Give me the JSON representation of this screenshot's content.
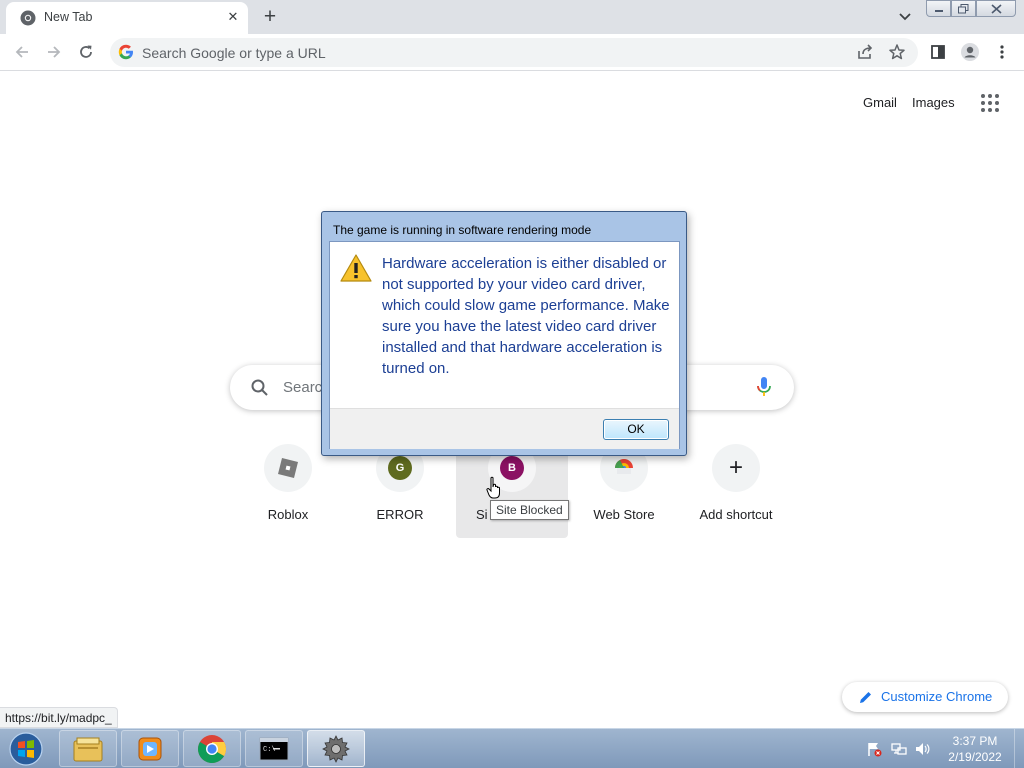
{
  "browser": {
    "tab": {
      "title": "New Tab",
      "favicon": "chrome-icon",
      "close": "✕"
    },
    "new_tab_symbol": "+",
    "omnibox": {
      "placeholder": "Search Google or type a URL"
    }
  },
  "ntp": {
    "links": {
      "gmail": "Gmail",
      "images": "Images"
    },
    "search_placeholder": "Search Google or type a URL",
    "search_visible_text": "Searc",
    "shortcuts": [
      {
        "label": "Roblox",
        "icon": "roblox-icon"
      },
      {
        "label": "ERROR",
        "icon": "letter-g-icon",
        "letter": "G",
        "color": "#5f6b1f"
      },
      {
        "label": "Site Blocked",
        "visible_label": "Si",
        "icon": "letter-b-icon",
        "letter": "B",
        "color": "#8b1163"
      },
      {
        "label": "Web Store",
        "icon": "web-store-icon"
      },
      {
        "label": "Add shortcut",
        "icon": "plus-icon",
        "symbol": "+"
      }
    ],
    "tooltip": "Site Blocked",
    "customize_label": "Customize Chrome",
    "status_url": "https://bit.ly/madpc_"
  },
  "dialog": {
    "title": "The game is running in software rendering mode",
    "message": "Hardware acceleration is either disabled or not supported by your video card driver, which could slow game performance. Make sure you have the latest video card driver installed and that hardware acceleration is turned on.",
    "ok_label": "OK",
    "icon": "warning-icon"
  },
  "taskbar": {
    "items": [
      "explorer-icon",
      "media-player-icon",
      "chrome-icon",
      "cmd-icon",
      "gear-app-icon"
    ],
    "time": "3:37 PM",
    "date": "2/19/2022"
  },
  "colors": {
    "accent": "#1a73e8",
    "dialog_text": "#1c3f94",
    "tab_strip": "#dee1e6"
  }
}
